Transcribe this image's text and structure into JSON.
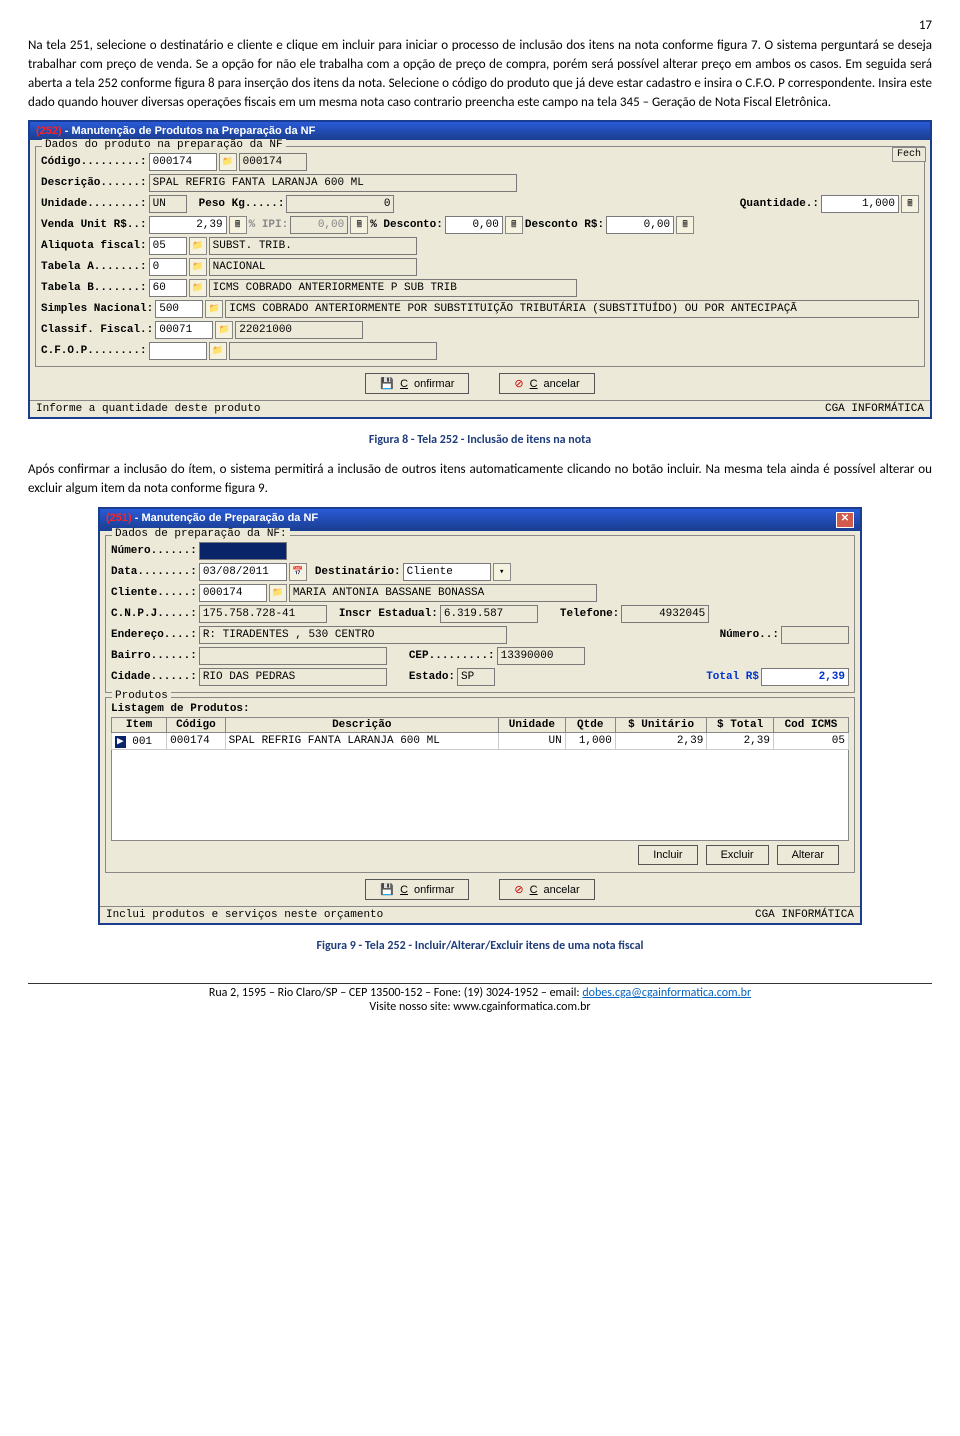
{
  "page_number": "17",
  "para1": "Na tela 251, selecione o destinatário e cliente e clique em incluir para iniciar o processo de inclusão dos itens na nota conforme figura 7. O sistema perguntará se deseja trabalhar com preço de venda. Se a opção for não ele trabalha com a opção de preço de compra, porém será possível alterar preço em ambos os casos. Em seguida será aberta a tela 252 conforme figura 8 para inserção dos itens da nota. Selecione o código do produto que já deve estar cadastro e insira o C.F.O. P correspondente. Insira este dado quando houver diversas operações fiscais em um mesma nota caso contrario preencha este campo na tela 345 – Geração de Nota Fiscal Eletrônica.",
  "caption1": "Figura 8 - Tela 252 - Inclusão de itens na nota",
  "para2": "Após confirmar a inclusão do ítem, o sistema permitirá a inclusão de outros itens automaticamente clicando no botão incluir. Na mesma tela ainda é possível alterar ou excluir algum item da nota conforme figura 9.",
  "caption2": "Figura 9 - Tela 252 - Incluir/Alterar/Excluir itens de uma nota fiscal",
  "footer_line1": "Rua 2, 1595 – Rio Claro/SP – CEP 13500-152 – Fone: (19) 3024-1952 – email: ",
  "footer_email": "dobes.cga@cgainformatica.com.br",
  "footer_line2_pre": "Visite nosso site: ",
  "footer_site": "www.cgainformatica.com.br",
  "win1": {
    "title_no": "(252)",
    "title_txt": " - Manutenção de Produtos na Preparação da NF",
    "box_label": "Dados do produto na preparação da NF",
    "fech": "Fech",
    "rows": {
      "codigo_lbl": "Código.........:",
      "codigo": "000174",
      "codigo2": "000174",
      "desc_lbl": "Descrição......:",
      "desc": "SPAL REFRIG FANTA LARANJA 600 ML",
      "unid_lbl": "Unidade........:",
      "unid": "UN",
      "peso_lbl": "Peso Kg.....:",
      "peso": "0",
      "qtd_lbl": "Quantidade.:",
      "qtd": "1,000",
      "venda_lbl": "Venda Unit R$..:",
      "venda": "2,39",
      "ipi_lbl": "% IPI:",
      "ipi": "0,00",
      "pdesc_lbl": "% Desconto:",
      "pdesc": "0,00",
      "rdesc_lbl": "Desconto R$:",
      "rdesc": "0,00",
      "aliq_lbl": "Aliquota fiscal:",
      "aliq": "05",
      "aliq_desc": "SUBST. TRIB.",
      "taba_lbl": "Tabela A.......:",
      "taba": "0",
      "taba_desc": "NACIONAL",
      "tabb_lbl": "Tabela B.......:",
      "tabb": "60",
      "tabb_desc": "ICMS COBRADO ANTERIORMENTE P SUB TRIB",
      "simp_lbl": "Simples Nacional:",
      "simp": "500",
      "simp_desc": "ICMS COBRADO ANTERIORMENTE POR SUBSTITUIÇÃO TRIBUTÁRIA (SUBSTITUÍDO) OU POR ANTECIPAÇÃ",
      "clf_lbl": "Classif. Fiscal.:",
      "clf": "00071",
      "clf_desc": "22021000",
      "cfop_lbl": "C.F.O.P........:"
    },
    "confirm": "Confirmar",
    "cancel": "Cancelar",
    "status_l": "Informe a quantidade deste produto",
    "status_r": "CGA INFORMÁTICA"
  },
  "win2": {
    "title_no": "(251)",
    "title_txt": " - Manutenção de Preparação da NF",
    "box1": "Dados de preparação da NF:",
    "num_lbl": "Número......:",
    "data_lbl": "Data........:",
    "data": "03/08/2011",
    "dest_lbl": "Destinatário:",
    "dest": "Cliente",
    "cli_lbl": "Cliente.....:",
    "cli": "000174",
    "cli_name": "MARIA ANTONIA BASSANE BONASSA",
    "cnpj_lbl": "C.N.P.J.....:",
    "cnpj": "175.758.728-41",
    "ie_lbl": "Inscr Estadual:",
    "ie": "6.319.587",
    "tel_lbl": "Telefone:",
    "tel": "4932045",
    "end_lbl": "Endereço....:",
    "end": "R: TIRADENTES , 530  CENTRO",
    "numc_lbl": "Número..:",
    "bairro_lbl": "Bairro......:",
    "cep_lbl": "CEP.........:",
    "cep": "13390000",
    "cid_lbl": "Cidade......:",
    "cid": "RIO DAS PEDRAS",
    "est_lbl": "Estado:",
    "est": "SP",
    "tot_lbl": "Total R$",
    "tot": "2,39",
    "tab_box": "Produtos",
    "list_lbl": "Listagem de Produtos:",
    "headers": [
      "Item",
      "Código",
      "Descrição",
      "Unidade",
      "Qtde",
      "$ Unitário",
      "$ Total",
      "Cod ICMS"
    ],
    "row": [
      "001",
      "000174",
      "SPAL REFRIG FANTA LARANJA 600 ML",
      "UN",
      "1,000",
      "2,39",
      "2,39",
      "05"
    ],
    "incluir": "Incluir",
    "excluir": "Excluir",
    "alterar": "Alterar",
    "confirm": "Confirmar",
    "cancel": "Cancelar",
    "status_l": "Inclui produtos e serviços neste orçamento",
    "status_r": "CGA INFORMÁTICA"
  }
}
